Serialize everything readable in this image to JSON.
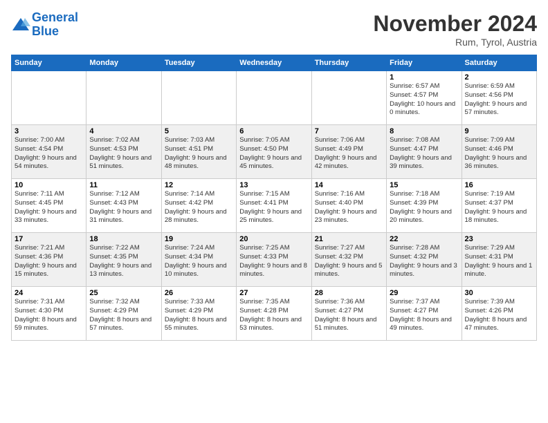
{
  "header": {
    "logo_line1": "General",
    "logo_line2": "Blue",
    "title": "November 2024",
    "location": "Rum, Tyrol, Austria"
  },
  "weekdays": [
    "Sunday",
    "Monday",
    "Tuesday",
    "Wednesday",
    "Thursday",
    "Friday",
    "Saturday"
  ],
  "weeks": [
    [
      {
        "day": "",
        "sunrise": "",
        "sunset": "",
        "daylight": ""
      },
      {
        "day": "",
        "sunrise": "",
        "sunset": "",
        "daylight": ""
      },
      {
        "day": "",
        "sunrise": "",
        "sunset": "",
        "daylight": ""
      },
      {
        "day": "",
        "sunrise": "",
        "sunset": "",
        "daylight": ""
      },
      {
        "day": "",
        "sunrise": "",
        "sunset": "",
        "daylight": ""
      },
      {
        "day": "1",
        "sunrise": "Sunrise: 6:57 AM",
        "sunset": "Sunset: 4:57 PM",
        "daylight": "Daylight: 10 hours and 0 minutes."
      },
      {
        "day": "2",
        "sunrise": "Sunrise: 6:59 AM",
        "sunset": "Sunset: 4:56 PM",
        "daylight": "Daylight: 9 hours and 57 minutes."
      }
    ],
    [
      {
        "day": "3",
        "sunrise": "Sunrise: 7:00 AM",
        "sunset": "Sunset: 4:54 PM",
        "daylight": "Daylight: 9 hours and 54 minutes."
      },
      {
        "day": "4",
        "sunrise": "Sunrise: 7:02 AM",
        "sunset": "Sunset: 4:53 PM",
        "daylight": "Daylight: 9 hours and 51 minutes."
      },
      {
        "day": "5",
        "sunrise": "Sunrise: 7:03 AM",
        "sunset": "Sunset: 4:51 PM",
        "daylight": "Daylight: 9 hours and 48 minutes."
      },
      {
        "day": "6",
        "sunrise": "Sunrise: 7:05 AM",
        "sunset": "Sunset: 4:50 PM",
        "daylight": "Daylight: 9 hours and 45 minutes."
      },
      {
        "day": "7",
        "sunrise": "Sunrise: 7:06 AM",
        "sunset": "Sunset: 4:49 PM",
        "daylight": "Daylight: 9 hours and 42 minutes."
      },
      {
        "day": "8",
        "sunrise": "Sunrise: 7:08 AM",
        "sunset": "Sunset: 4:47 PM",
        "daylight": "Daylight: 9 hours and 39 minutes."
      },
      {
        "day": "9",
        "sunrise": "Sunrise: 7:09 AM",
        "sunset": "Sunset: 4:46 PM",
        "daylight": "Daylight: 9 hours and 36 minutes."
      }
    ],
    [
      {
        "day": "10",
        "sunrise": "Sunrise: 7:11 AM",
        "sunset": "Sunset: 4:45 PM",
        "daylight": "Daylight: 9 hours and 33 minutes."
      },
      {
        "day": "11",
        "sunrise": "Sunrise: 7:12 AM",
        "sunset": "Sunset: 4:43 PM",
        "daylight": "Daylight: 9 hours and 31 minutes."
      },
      {
        "day": "12",
        "sunrise": "Sunrise: 7:14 AM",
        "sunset": "Sunset: 4:42 PM",
        "daylight": "Daylight: 9 hours and 28 minutes."
      },
      {
        "day": "13",
        "sunrise": "Sunrise: 7:15 AM",
        "sunset": "Sunset: 4:41 PM",
        "daylight": "Daylight: 9 hours and 25 minutes."
      },
      {
        "day": "14",
        "sunrise": "Sunrise: 7:16 AM",
        "sunset": "Sunset: 4:40 PM",
        "daylight": "Daylight: 9 hours and 23 minutes."
      },
      {
        "day": "15",
        "sunrise": "Sunrise: 7:18 AM",
        "sunset": "Sunset: 4:39 PM",
        "daylight": "Daylight: 9 hours and 20 minutes."
      },
      {
        "day": "16",
        "sunrise": "Sunrise: 7:19 AM",
        "sunset": "Sunset: 4:37 PM",
        "daylight": "Daylight: 9 hours and 18 minutes."
      }
    ],
    [
      {
        "day": "17",
        "sunrise": "Sunrise: 7:21 AM",
        "sunset": "Sunset: 4:36 PM",
        "daylight": "Daylight: 9 hours and 15 minutes."
      },
      {
        "day": "18",
        "sunrise": "Sunrise: 7:22 AM",
        "sunset": "Sunset: 4:35 PM",
        "daylight": "Daylight: 9 hours and 13 minutes."
      },
      {
        "day": "19",
        "sunrise": "Sunrise: 7:24 AM",
        "sunset": "Sunset: 4:34 PM",
        "daylight": "Daylight: 9 hours and 10 minutes."
      },
      {
        "day": "20",
        "sunrise": "Sunrise: 7:25 AM",
        "sunset": "Sunset: 4:33 PM",
        "daylight": "Daylight: 9 hours and 8 minutes."
      },
      {
        "day": "21",
        "sunrise": "Sunrise: 7:27 AM",
        "sunset": "Sunset: 4:32 PM",
        "daylight": "Daylight: 9 hours and 5 minutes."
      },
      {
        "day": "22",
        "sunrise": "Sunrise: 7:28 AM",
        "sunset": "Sunset: 4:32 PM",
        "daylight": "Daylight: 9 hours and 3 minutes."
      },
      {
        "day": "23",
        "sunrise": "Sunrise: 7:29 AM",
        "sunset": "Sunset: 4:31 PM",
        "daylight": "Daylight: 9 hours and 1 minute."
      }
    ],
    [
      {
        "day": "24",
        "sunrise": "Sunrise: 7:31 AM",
        "sunset": "Sunset: 4:30 PM",
        "daylight": "Daylight: 8 hours and 59 minutes."
      },
      {
        "day": "25",
        "sunrise": "Sunrise: 7:32 AM",
        "sunset": "Sunset: 4:29 PM",
        "daylight": "Daylight: 8 hours and 57 minutes."
      },
      {
        "day": "26",
        "sunrise": "Sunrise: 7:33 AM",
        "sunset": "Sunset: 4:29 PM",
        "daylight": "Daylight: 8 hours and 55 minutes."
      },
      {
        "day": "27",
        "sunrise": "Sunrise: 7:35 AM",
        "sunset": "Sunset: 4:28 PM",
        "daylight": "Daylight: 8 hours and 53 minutes."
      },
      {
        "day": "28",
        "sunrise": "Sunrise: 7:36 AM",
        "sunset": "Sunset: 4:27 PM",
        "daylight": "Daylight: 8 hours and 51 minutes."
      },
      {
        "day": "29",
        "sunrise": "Sunrise: 7:37 AM",
        "sunset": "Sunset: 4:27 PM",
        "daylight": "Daylight: 8 hours and 49 minutes."
      },
      {
        "day": "30",
        "sunrise": "Sunrise: 7:39 AM",
        "sunset": "Sunset: 4:26 PM",
        "daylight": "Daylight: 8 hours and 47 minutes."
      }
    ]
  ]
}
